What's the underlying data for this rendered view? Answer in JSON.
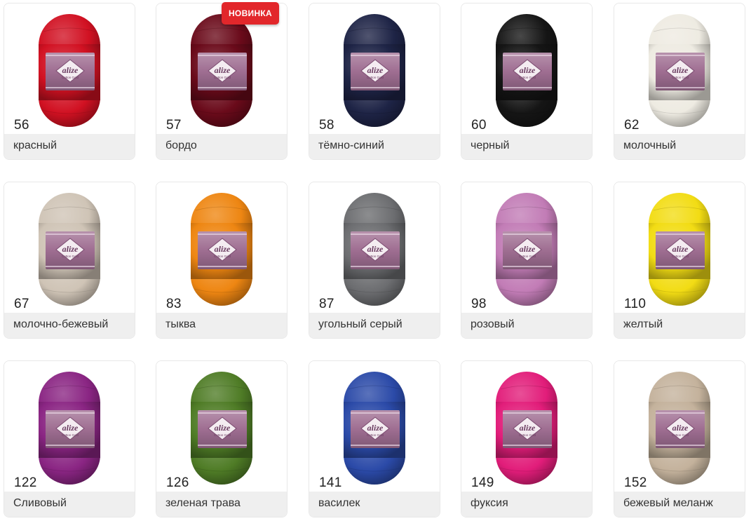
{
  "badge": "НОВИНКА",
  "colors": [
    {
      "code": "56",
      "name": "красный",
      "hex": "#d11122"
    },
    {
      "code": "57",
      "name": "бордо",
      "hex": "#6a0a1a"
    },
    {
      "code": "58",
      "name": "тёмно-синий",
      "hex": "#1e2446"
    },
    {
      "code": "60",
      "name": "черный",
      "hex": "#151515"
    },
    {
      "code": "62",
      "name": "молочный",
      "hex": "#eeebe2"
    },
    {
      "code": "67",
      "name": "молочно-бежевый",
      "hex": "#cfc4b6"
    },
    {
      "code": "83",
      "name": "тыква",
      "hex": "#ee8612"
    },
    {
      "code": "87",
      "name": "угольный серый",
      "hex": "#6c6d70"
    },
    {
      "code": "98",
      "name": "розовый",
      "hex": "#c27cb6"
    },
    {
      "code": "110",
      "name": "желтый",
      "hex": "#f2dc14"
    },
    {
      "code": "122",
      "name": "Сливовый",
      "hex": "#8a2583"
    },
    {
      "code": "126",
      "name": "зеленая трава",
      "hex": "#4f7c26"
    },
    {
      "code": "141",
      "name": "василек",
      "hex": "#2b4aa8"
    },
    {
      "code": "149",
      "name": "фуксия",
      "hex": "#e21d7a"
    },
    {
      "code": "152",
      "name": "бежевый меланж",
      "hex": "#c4b29c"
    }
  ],
  "skein": {
    "brand": "alize",
    "product": "Cotton Gold",
    "band_hex": "#9f6e92"
  }
}
